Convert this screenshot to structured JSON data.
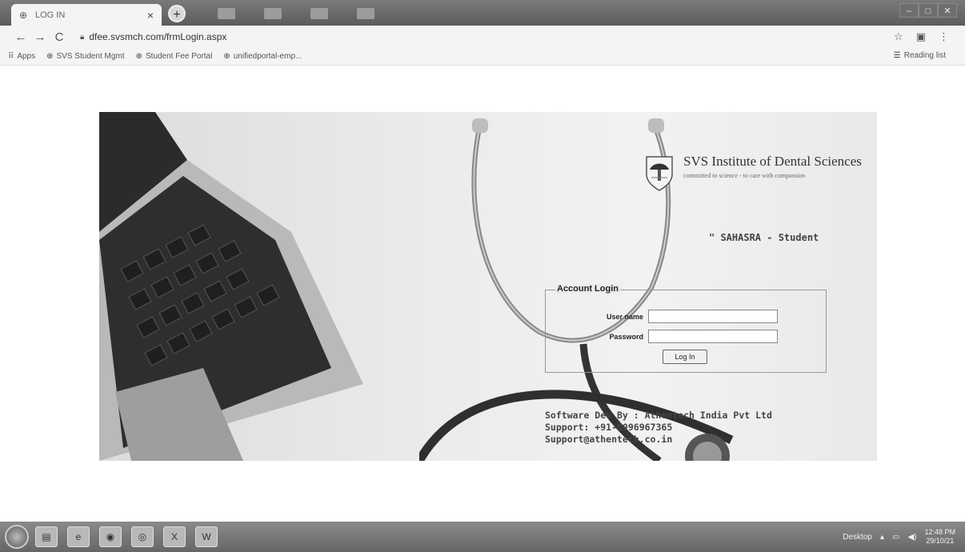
{
  "browser": {
    "tab_title": "LOG IN",
    "tab_close": "×",
    "new_tab": "+",
    "url": "dfee.svsmch.com/frmLogin.aspx",
    "back": "←",
    "forward": "→",
    "reload": "C",
    "bookmarks": [
      {
        "label": "Apps",
        "icon": "apps-grid-icon"
      },
      {
        "label": "SVS Student Mgmt",
        "icon": "globe-icon"
      },
      {
        "label": "Student Fee Portal",
        "icon": "globe-icon"
      },
      {
        "label": "unifiedportal-emp...",
        "icon": "globe-icon"
      }
    ],
    "reading_list": "Reading list"
  },
  "page": {
    "institute_name": "SVS Institute of Dental Sciences",
    "institute_tagline": "committed to science - to care with compassion",
    "app_title": "\" SAHASRA - Student",
    "login": {
      "legend": "Account Login",
      "username_label": "User name",
      "password_label": "Password",
      "username_value": "",
      "password_value": "",
      "button_label": "Log In"
    },
    "credits": {
      "line1": "Software Dev By : Athentech India Pvt Ltd",
      "line2": "Support: +91-8096967365",
      "line3": "Support@athentech.co.in"
    }
  },
  "taskbar": {
    "desktop_label": "Desktop",
    "time": "12:48 PM",
    "date": "29/10/21"
  },
  "colors": {
    "chrome_dark": "#5c5c5c",
    "chrome_light": "#f4f4f4",
    "hero_bg": "#ececec"
  }
}
